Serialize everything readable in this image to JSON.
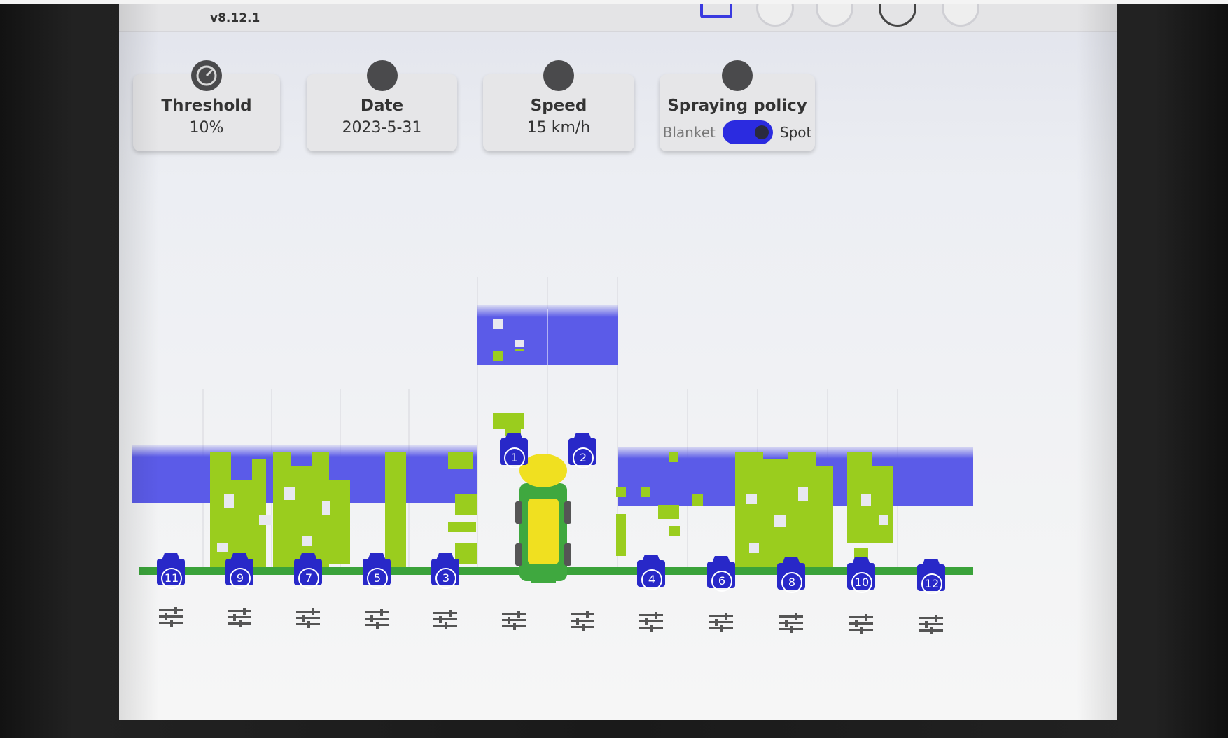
{
  "app": {
    "version": "v8.12.1"
  },
  "settings": {
    "threshold": {
      "title": "Threshold",
      "value": "10%",
      "icon": "gauge-icon"
    },
    "date": {
      "title": "Date",
      "value": "2023-5-31",
      "icon": "calendar-icon"
    },
    "speed": {
      "title": "Speed",
      "value": "15 km/h",
      "icon": "speedometer-icon"
    },
    "spraying_policy": {
      "title": "Spraying policy",
      "left_option": "Blanket",
      "right_option": "Spot",
      "selected": "Spot",
      "icon": "spray-icon"
    }
  },
  "boom": {
    "nozzles": [
      {
        "label": "11"
      },
      {
        "label": "9"
      },
      {
        "label": "7"
      },
      {
        "label": "5"
      },
      {
        "label": "3"
      },
      {
        "label": "1"
      },
      {
        "label": "2"
      },
      {
        "label": "4"
      },
      {
        "label": "6"
      },
      {
        "label": "8"
      },
      {
        "label": "10"
      },
      {
        "label": "12"
      }
    ],
    "settings_icon": "sliders-icon"
  },
  "colors": {
    "spray_zone": "#5b5be8",
    "weed_detection": "#9acd1e",
    "boom_line": "#3aa23a",
    "nozzle": "#2828c8",
    "toggle_active": "#2b2be0",
    "tractor_body": "#3fa83f",
    "tractor_cab": "#f0e020"
  }
}
